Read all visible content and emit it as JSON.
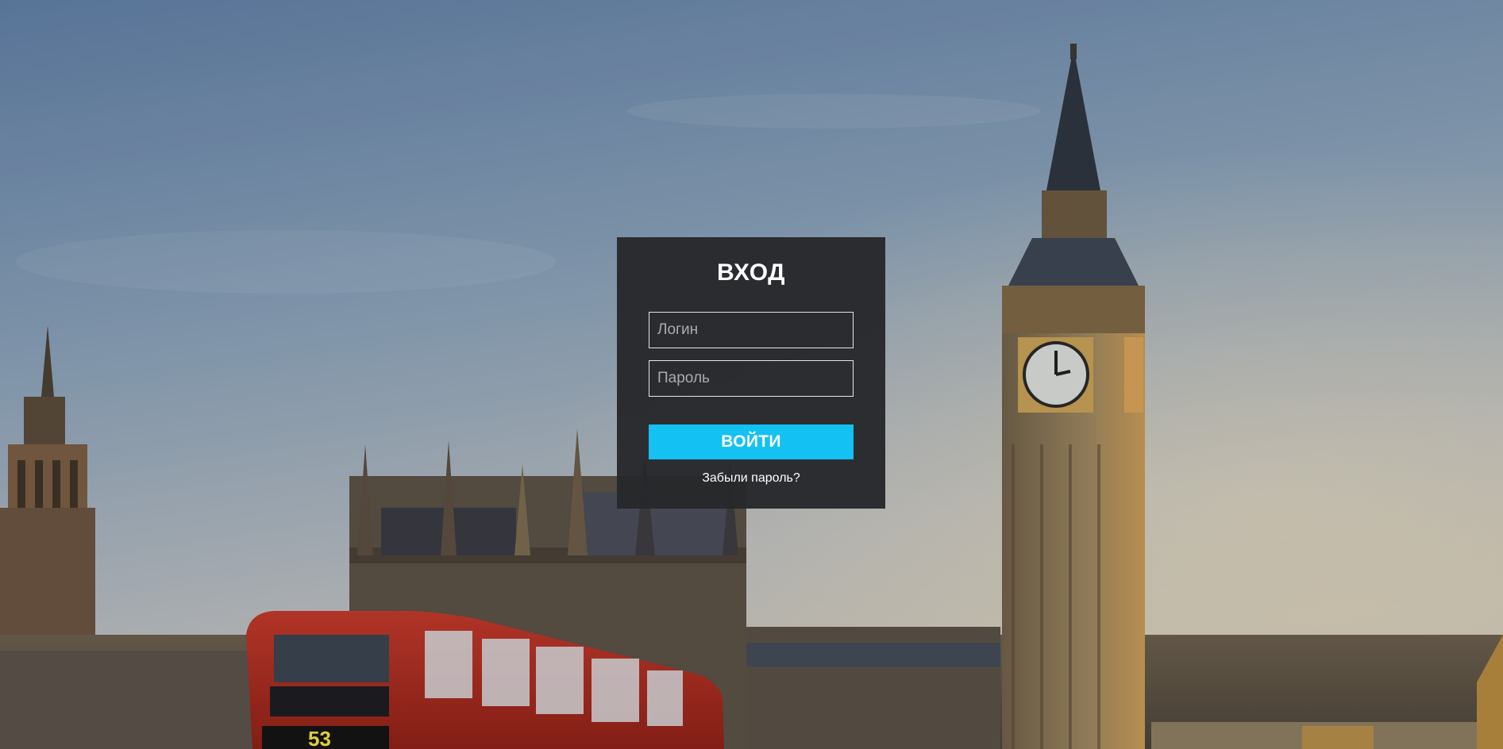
{
  "login": {
    "title": "ВХОД",
    "username_placeholder": "Логин",
    "password_placeholder": "Пароль",
    "submit_label": "ВОЙТИ",
    "forgot_link": "Забыли пароль?"
  },
  "background": {
    "bus_route": "53"
  },
  "colors": {
    "accent": "#13c1f3",
    "panel": "#26282b"
  }
}
